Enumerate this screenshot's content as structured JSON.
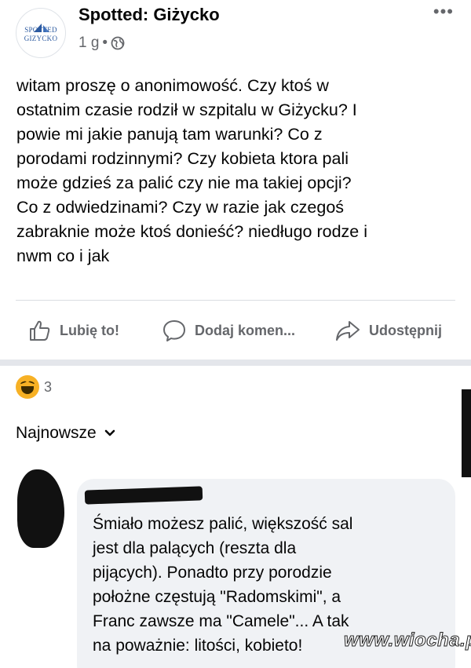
{
  "post": {
    "page_name": "Spotted: Giżycko",
    "avatar_line1": "SPOTTED",
    "avatar_line2": "GIZYCKO",
    "time": "1 g",
    "meta_dot": "•",
    "more": "•••",
    "text_lines": [
      "witam proszę o anonimowość. Czy ktoś w",
      "ostatnim czasie rodził w szpitalu w Giżycku? I",
      "powie mi jakie panują tam warunki? Co z",
      "porodami rodzinnymi? Czy kobieta ktora pali",
      "może gdzieś za palić czy nie ma takiej opcji?",
      "Co z odwiedzinami? Czy w razie jak czegoś",
      "zabraknie może ktoś donieść? niedługo rodze i",
      "nwm co i jak"
    ]
  },
  "actions": {
    "like": "Lubię to!",
    "comment": "Dodaj komen...",
    "share": "Udostępnij"
  },
  "reactions": {
    "count": "3",
    "icon": "haha-emoji"
  },
  "sort": {
    "label": "Najnowsze"
  },
  "comment": {
    "text_lines": [
      "Śmiało możesz palić, większość sal",
      "jest dla palących (reszta dla",
      "pijących). Ponadto przy porodzie",
      "położne częstują \"Radomskimi\", a",
      "Franc zawsze ma \"Camele\"... A tak",
      "na poważnie: litości, kobieto!"
    ]
  },
  "watermark": "www.wiocha.pl"
}
